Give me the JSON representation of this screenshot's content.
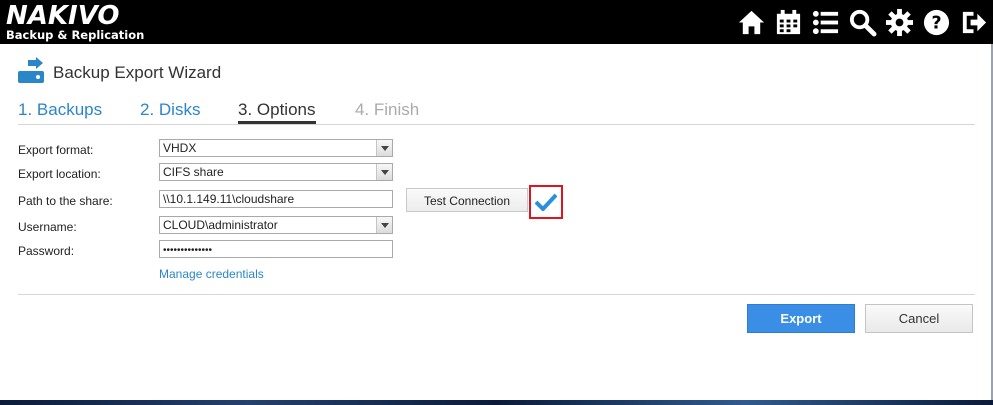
{
  "brand": {
    "name": "NAKIVO",
    "subtitle": "Backup & Replication"
  },
  "topbar": {
    "icons": [
      "home-icon",
      "calendar-icon",
      "list-icon",
      "search-icon",
      "gear-icon",
      "help-icon",
      "logout-icon"
    ]
  },
  "wizard": {
    "title": "Backup Export Wizard",
    "steps": [
      {
        "label": "1. Backups",
        "state": "done"
      },
      {
        "label": "2. Disks",
        "state": "done"
      },
      {
        "label": "3. Options",
        "state": "active"
      },
      {
        "label": "4. Finish",
        "state": "todo"
      }
    ]
  },
  "form": {
    "export_format": {
      "label": "Export format:",
      "value": "VHDX"
    },
    "export_location": {
      "label": "Export location:",
      "value": "CIFS share"
    },
    "path": {
      "label": "Path to the share:",
      "value": "\\\\10.1.149.11\\cloudshare"
    },
    "username": {
      "label": "Username:",
      "value": "CLOUD\\administrator"
    },
    "password": {
      "label": "Password:",
      "value": "••••••••••••••"
    },
    "test_connection": "Test Connection",
    "manage_credentials": "Manage credentials"
  },
  "actions": {
    "export": "Export",
    "cancel": "Cancel"
  },
  "colors": {
    "accent": "#3a8ee6",
    "link": "#2b86c9",
    "highlight": "#e0141e",
    "check": "#2b8fe0"
  }
}
